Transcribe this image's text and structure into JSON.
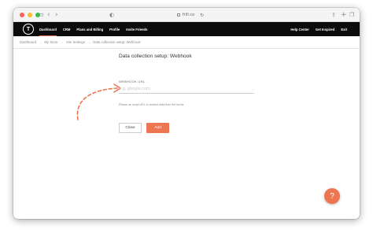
{
  "browser": {
    "url": "frill.co",
    "icons": {
      "sidebar": "sidebar-icon",
      "back": "chevron-left-icon",
      "forward": "chevron-right-icon",
      "shield": "shield-icon",
      "reload": "reload-icon",
      "share": "share-icon",
      "new_tab": "plus-icon",
      "tabs": "tabs-icon"
    }
  },
  "nav": {
    "logo_letter": "T",
    "items": [
      {
        "label": "Dashboard",
        "active": true
      },
      {
        "label": "CRM"
      },
      {
        "label": "Plans and Billing"
      },
      {
        "label": "Profile"
      },
      {
        "label": "Invite Friends"
      }
    ],
    "right_items": [
      {
        "label": "Help Center"
      },
      {
        "label": "Get Inspired"
      },
      {
        "label": "Exit"
      }
    ]
  },
  "breadcrumb": [
    "Dashboard",
    "My Store",
    "Site Settings",
    "Data collection setup: Webhook"
  ],
  "breadcrumb_separator": "→",
  "form": {
    "title": "Data collection setup: Webhook",
    "field_label": "WEBHOOK URL",
    "field_placeholder": "e.g. google.com",
    "field_value": "",
    "helper": "Please an script URL to receive data from the forms",
    "close_label": "Close",
    "add_label": "Add"
  },
  "help_button": "?",
  "colors": {
    "accent": "#ee7552",
    "nav_bg": "#0b0b0b",
    "traffic_red": "#ff5f57",
    "traffic_yellow": "#febc2e",
    "traffic_green": "#28c840"
  }
}
